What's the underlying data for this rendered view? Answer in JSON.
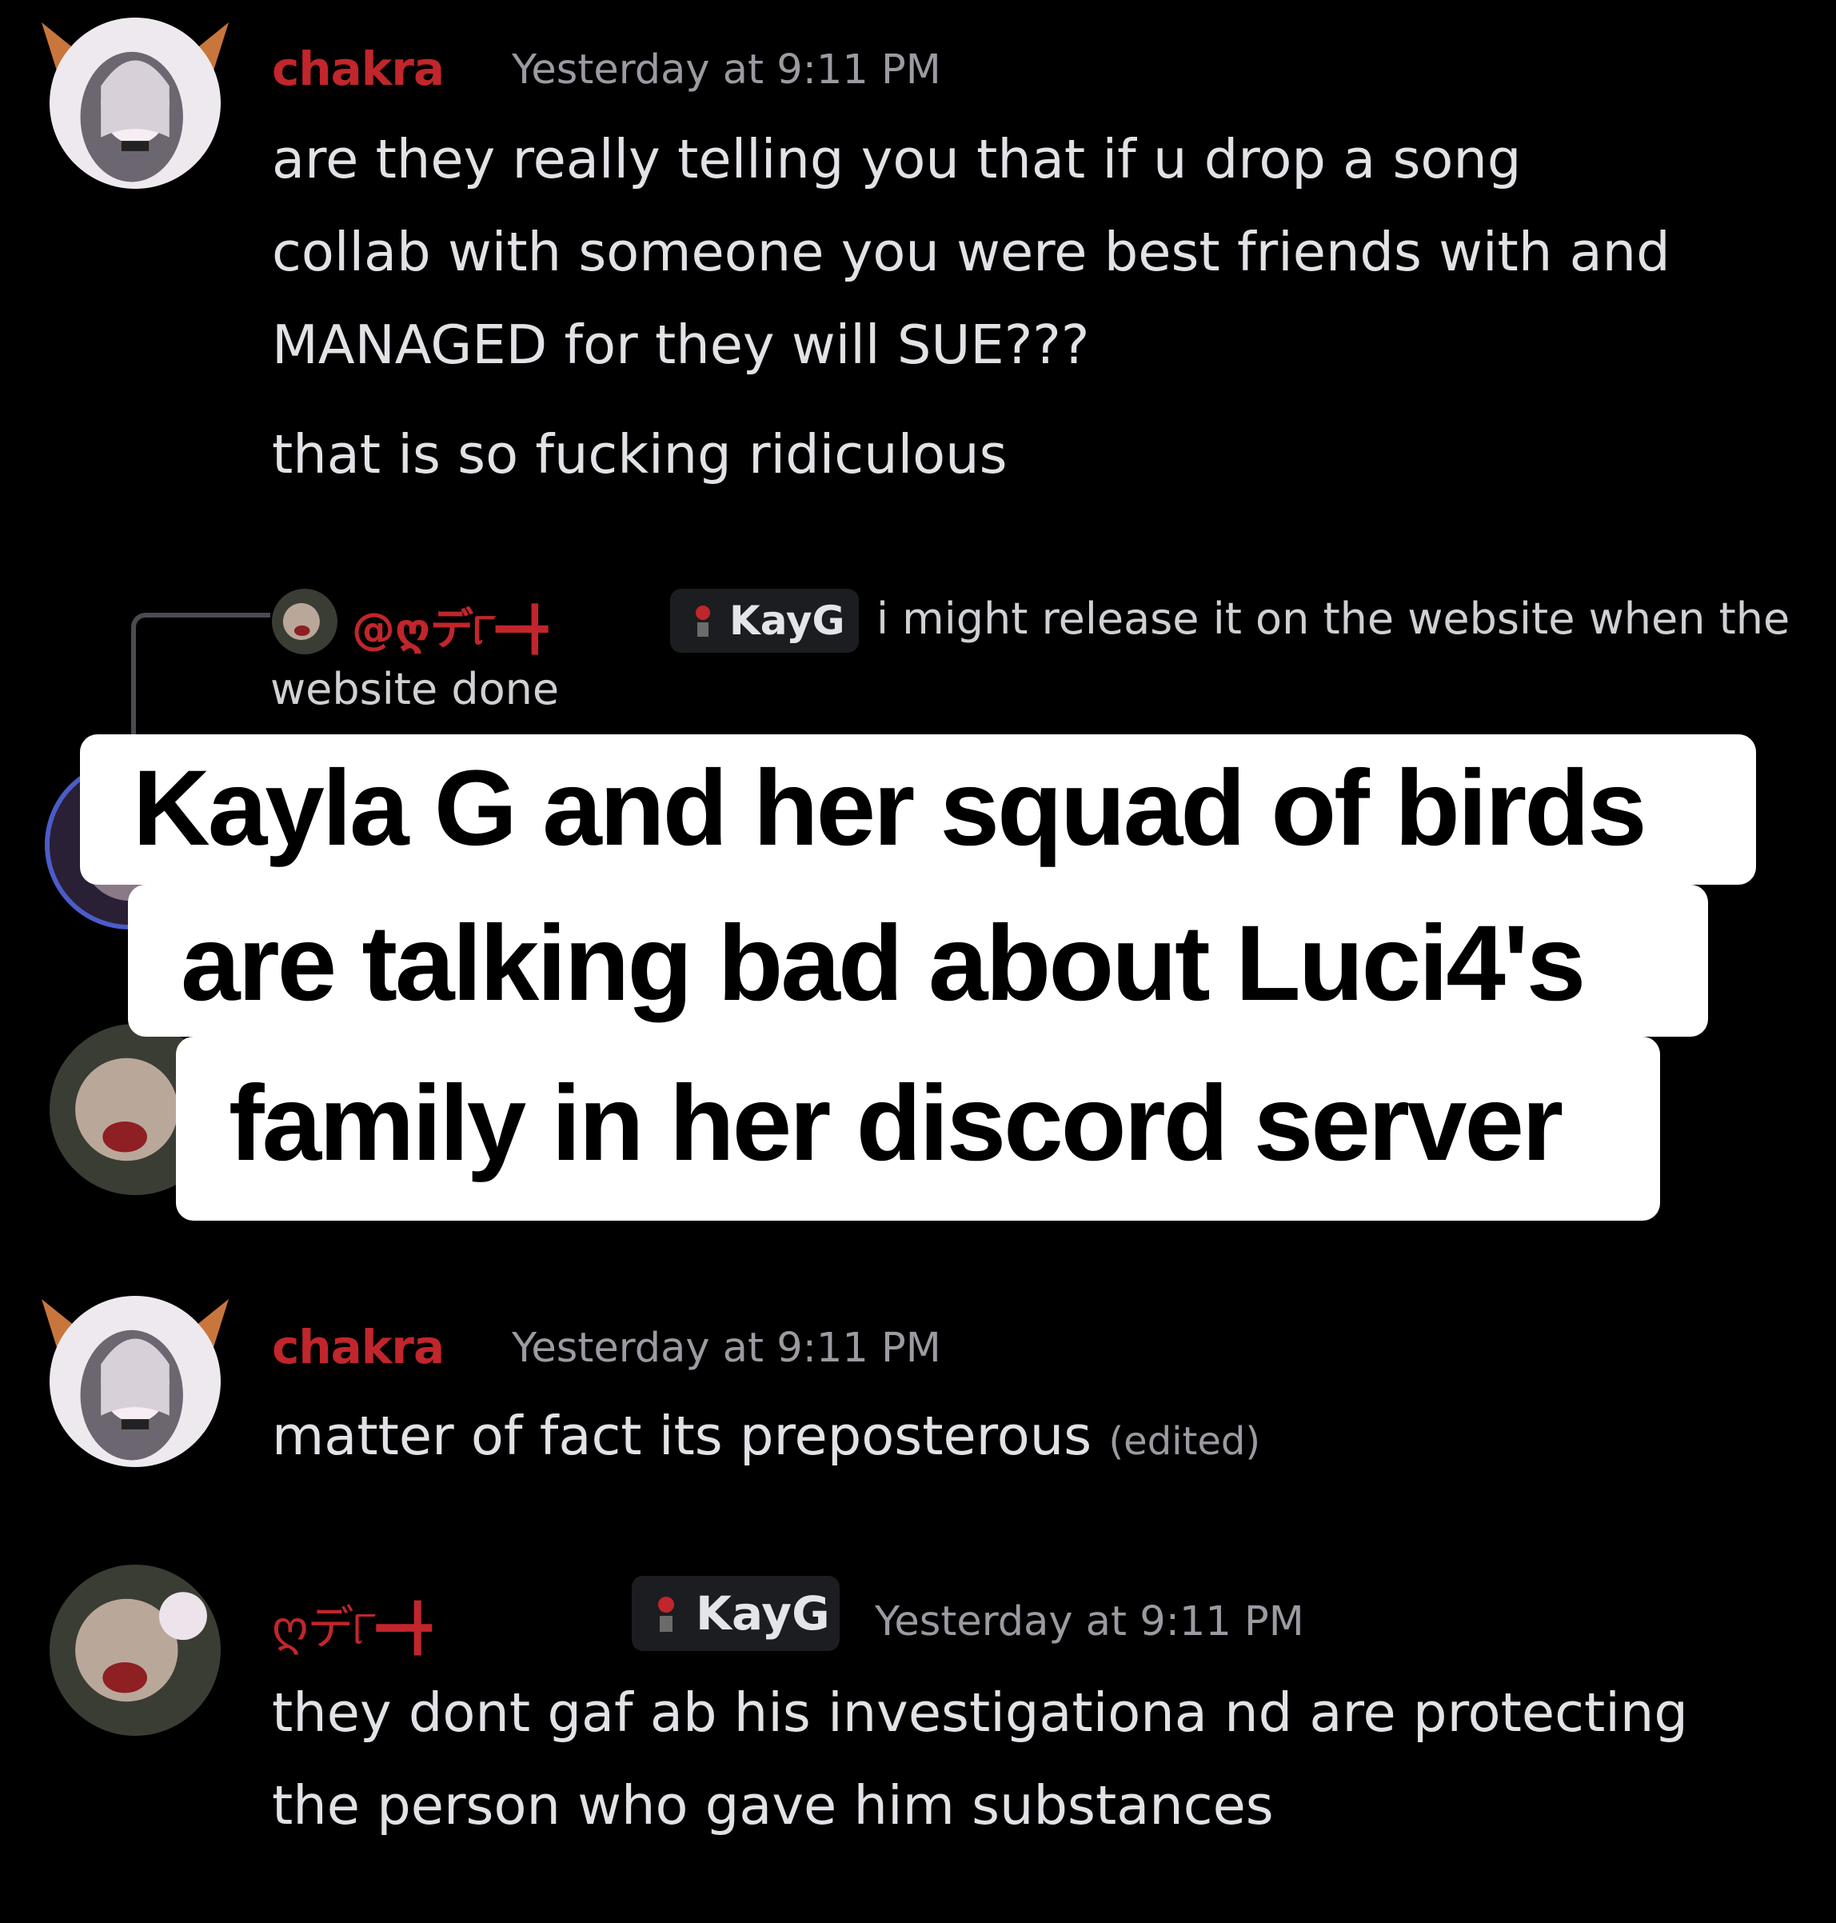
{
  "messages": [
    {
      "author": "chakra",
      "timestamp": "Yesterday at 9:11 PM",
      "lines": [
        "are they really telling you that if u drop a song",
        "collab with someone you were best friends with and",
        "MANAGED for they will SUE???"
      ],
      "followup": "that is so fucking ridiculous"
    },
    {
      "reply_mention": "@ღデ୮━╋",
      "reply_tag": "KayG",
      "reply_text_1": "i might release it on the website when the",
      "reply_text_2": "website done"
    },
    {
      "author": "chakra",
      "timestamp": "Yesterday at 9:11 PM",
      "text": "matter of fact its preposterous",
      "edited": "(edited)"
    },
    {
      "author": "ღデ୮━╋",
      "tag": "KayG",
      "timestamp": "Yesterday at 9:11 PM",
      "lines": [
        "they dont gaf ab his investigationa nd are protecting",
        "the person who gave him substances"
      ]
    }
  ],
  "caption": {
    "line1": "Kayla G and her squad of birds",
    "line2": "are talking bad about Luci4's",
    "line3": "family in her discord server"
  },
  "colors": {
    "background": "#000000",
    "username": "#c0262b",
    "timestamp": "#9a9ba1",
    "message_text": "#e1e2e5",
    "caption_bg": "#ffffff"
  }
}
